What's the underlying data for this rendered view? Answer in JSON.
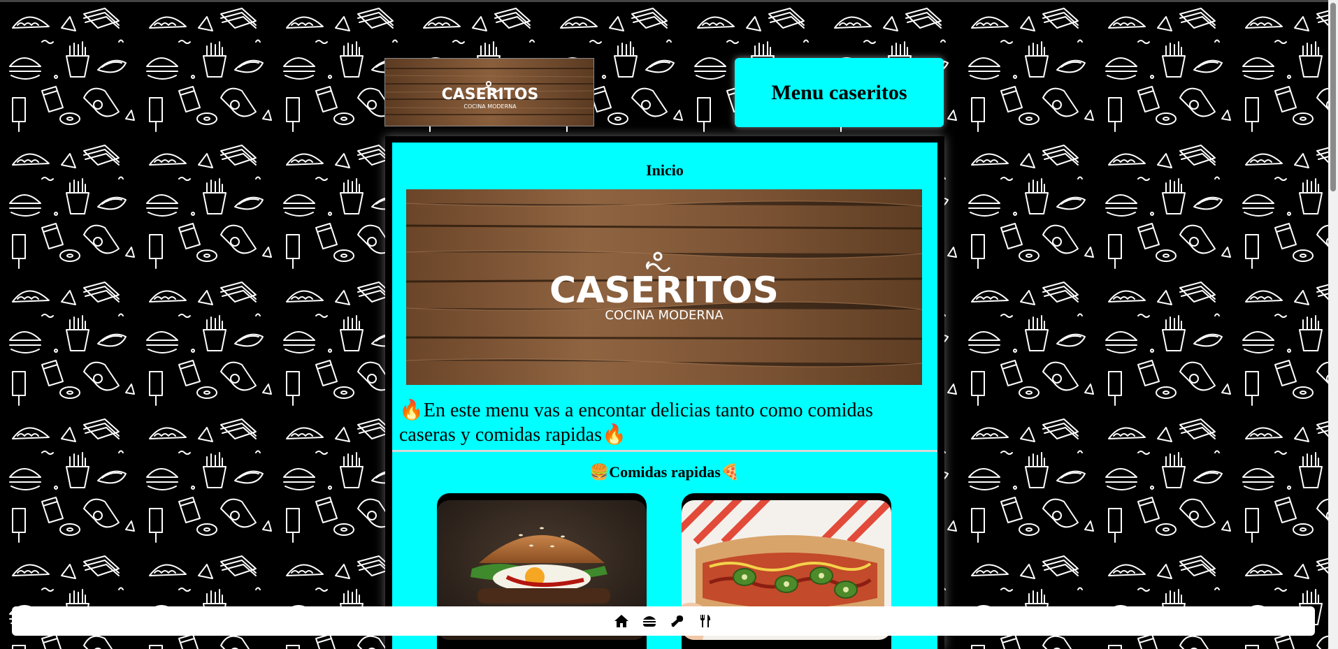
{
  "header": {
    "logo": {
      "brand": "CASERITOS",
      "tagline": "COCINA MODERNA"
    },
    "title": "Menu caseritos"
  },
  "inicio": {
    "title": "Inicio",
    "banner": {
      "brand": "CASERITOS",
      "tagline": "COCINA MODERNA"
    },
    "description": "🔥En este menu vas a encontar delicias tanto como comidas caseras y comidas rapidas🔥"
  },
  "comidas_rapidas": {
    "title": "🍔Comidas rapidas🍕",
    "cards": [
      {
        "icon": "burger-photo"
      },
      {
        "icon": "hotdog-photo"
      }
    ]
  },
  "bottom_nav": {
    "items": [
      {
        "icon": "home-icon"
      },
      {
        "icon": "burger-icon"
      },
      {
        "icon": "drumstick-icon"
      },
      {
        "icon": "utensils-icon"
      }
    ]
  },
  "colors": {
    "accent": "#00ffff",
    "background": "#000000",
    "nav_background": "#ffffff"
  }
}
